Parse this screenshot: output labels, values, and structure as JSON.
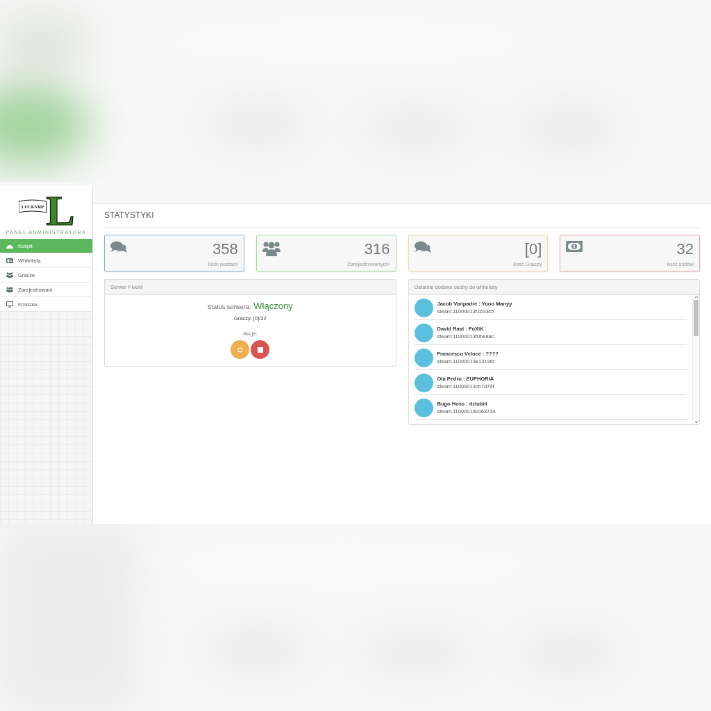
{
  "logo": {
    "letter": "L",
    "banner": "LUCKYRP"
  },
  "sidebar": {
    "caption": "PANEL ADMINISTRATORA",
    "items": [
      {
        "label": "Kokpit",
        "kind": "dashboard",
        "selected": true
      },
      {
        "label": "Whitelista",
        "kind": "idcard",
        "selected": false
      },
      {
        "label": "Gracze",
        "kind": "users",
        "selected": false
      },
      {
        "label": "Zarejestrowani",
        "kind": "users",
        "selected": false
      },
      {
        "label": "Konsola",
        "kind": "monitor",
        "selected": false
      }
    ]
  },
  "page_title": "STATYSTYKI",
  "stats": [
    {
      "value": "358",
      "label": "Ilośc postaci!",
      "kind": "comments",
      "color": "#8fb4cf"
    },
    {
      "value": "316",
      "label": "Zarejestrowanych!",
      "kind": "users",
      "color": "#a8d8a0"
    },
    {
      "value": "[0]",
      "label": "Ilość Graczy",
      "kind": "comments",
      "color": "#f0d9a8"
    },
    {
      "value": "32",
      "label": "Ilość slotów",
      "kind": "money",
      "color": "#e3a9a3"
    }
  ],
  "server_panel": {
    "title": "Serwer FiveM",
    "status_label": "Status serwera:",
    "status": "Włączony",
    "online": true,
    "players": "Graczy: [0]/32",
    "actions_label": "Akcje:",
    "actions": [
      {
        "kind": "restart"
      },
      {
        "kind": "stop"
      }
    ]
  },
  "whitelist_panel": {
    "title": "Ostatnie dodane osoby do whitelisty",
    "items": [
      {
        "name": "Jacob Vonpadre : Yooo Manyy",
        "id": "steam:11000013f1633c5"
      },
      {
        "name": "David Rast : FoXiK",
        "id": "steam:11000013f0be8ac"
      },
      {
        "name": "Francesco Veloce : ????",
        "id": "steam:11000013e1319fd"
      },
      {
        "name": "Ola Pedro : EUPHORIA",
        "id": "steam:11000013cb7d79f"
      },
      {
        "name": "Bugo Hoss : dziubiii",
        "id": "steam:11000013c063734"
      }
    ]
  }
}
